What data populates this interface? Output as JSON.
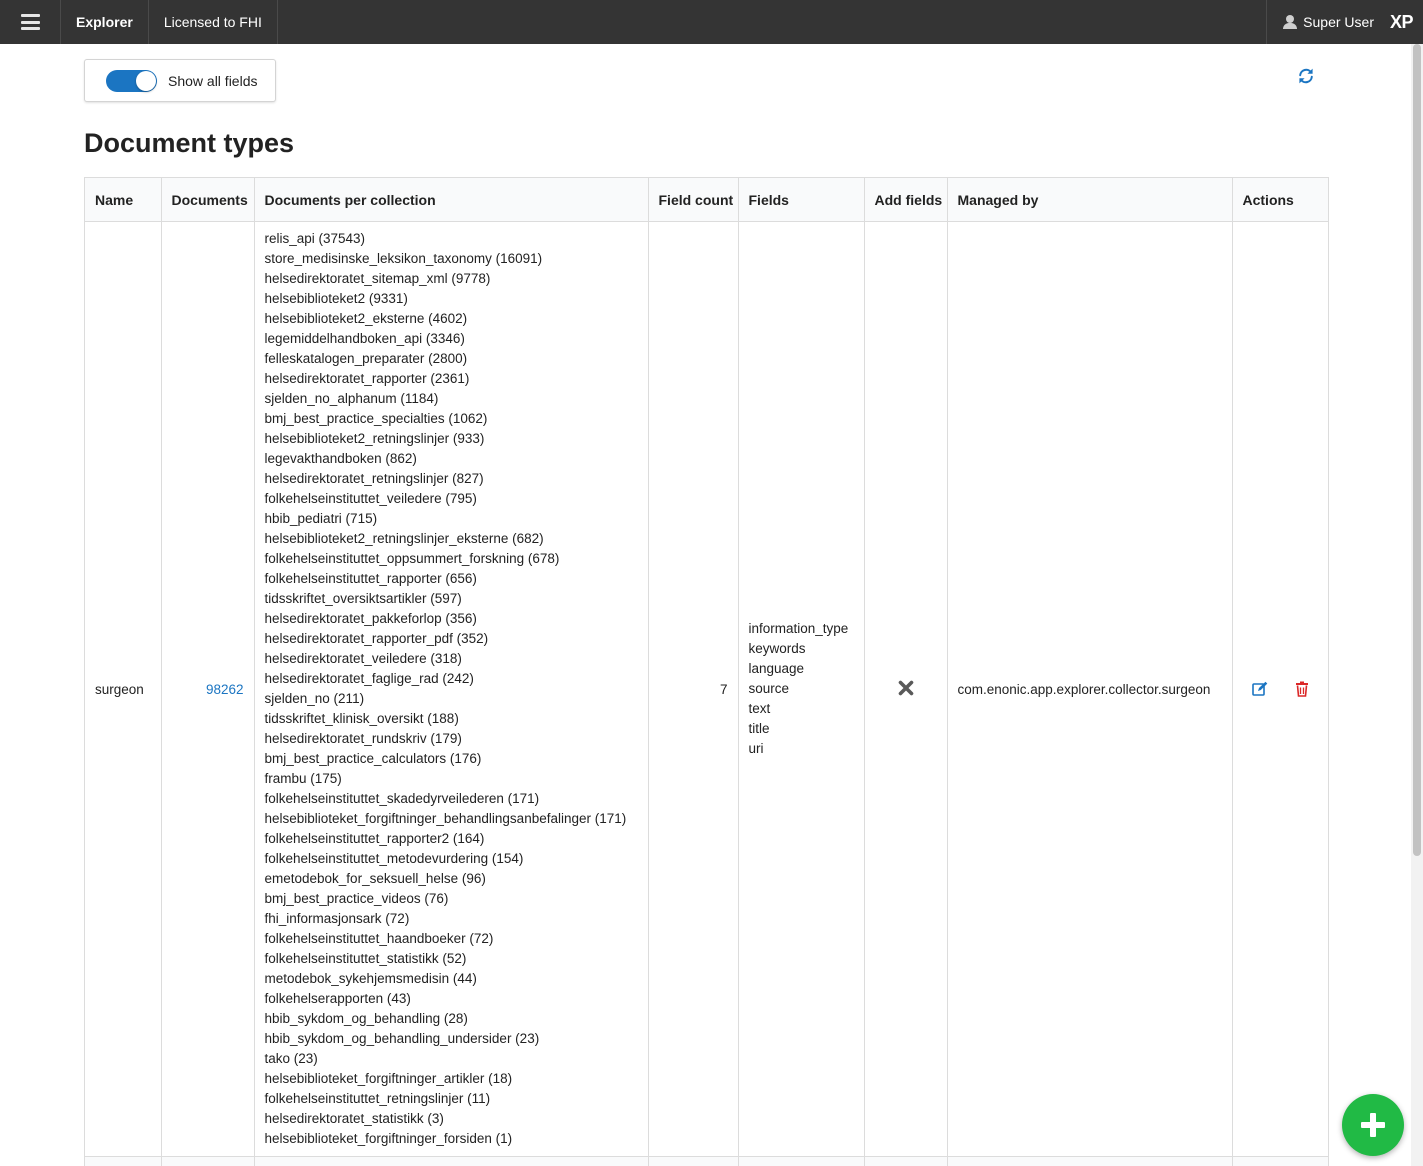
{
  "topbar": {
    "nav_items": [
      "Explorer",
      "Licensed to FHI"
    ],
    "user": "Super User",
    "logo": "XP",
    "menu_icon": "hamburger-icon",
    "user_icon": "user-icon"
  },
  "toolbar": {
    "toggle_label": "Show all fields",
    "toggle_on": true,
    "refresh_icon": "refresh-icon"
  },
  "page_title": "Document types",
  "table": {
    "columns": [
      "Name",
      "Documents",
      "Documents per collection",
      "Field count",
      "Fields",
      "Add fields",
      "Managed by",
      "Actions"
    ],
    "rows": [
      {
        "name": "surgeon",
        "documents": "98262",
        "collections": [
          "relis_api (37543)",
          "store_medisinske_leksikon_taxonomy (16091)",
          "helsedirektoratet_sitemap_xml (9778)",
          "helsebiblioteket2 (9331)",
          "helsebiblioteket2_eksterne (4602)",
          "legemiddelhandboken_api (3346)",
          "felleskatalogen_preparater (2800)",
          "helsedirektoratet_rapporter (2361)",
          "sjelden_no_alphanum (1184)",
          "bmj_best_practice_specialties (1062)",
          "helsebiblioteket2_retningslinjer (933)",
          "legevakthandboken (862)",
          "helsedirektoratet_retningslinjer (827)",
          "folkehelseinstituttet_veiledere (795)",
          "hbib_pediatri (715)",
          "helsebiblioteket2_retningslinjer_eksterne (682)",
          "folkehelseinstituttet_oppsummert_forskning (678)",
          "folkehelseinstituttet_rapporter (656)",
          "tidsskriftet_oversiktsartikler (597)",
          "helsedirektoratet_pakkeforlop (356)",
          "helsedirektoratet_rapporter_pdf (352)",
          "helsedirektoratet_veiledere (318)",
          "helsedirektoratet_faglige_rad (242)",
          "sjelden_no (211)",
          "tidsskriftet_klinisk_oversikt (188)",
          "helsedirektoratet_rundskriv (179)",
          "bmj_best_practice_calculators (176)",
          "frambu (175)",
          "folkehelseinstituttet_skadedyrveilederen (171)",
          "helsebiblioteket_forgiftninger_behandlingsanbefalinger (171)",
          "folkehelseinstituttet_rapporter2 (164)",
          "folkehelseinstituttet_metodevurdering (154)",
          "emetodebok_for_seksuell_helse (96)",
          "bmj_best_practice_videos (76)",
          "fhi_informasjonsark (72)",
          "folkehelseinstituttet_haandboeker (72)",
          "folkehelseinstituttet_statistikk (52)",
          "metodebok_sykehjemsmedisin (44)",
          "folkehelserapporten (43)",
          "hbib_sykdom_og_behandling (28)",
          "hbib_sykdom_og_behandling_undersider (23)",
          "tako (23)",
          "helsebiblioteket_forgiftninger_artikler (18)",
          "folkehelseinstituttet_retningslinjer (11)",
          "helsedirektoratet_statistikk (3)",
          "helsebiblioteket_forgiftninger_forsiden (1)"
        ],
        "field_count": "7",
        "fields": [
          "information_type",
          "keywords",
          "language",
          "source",
          "text",
          "title",
          "uri"
        ],
        "add_fields_icon": "close-icon",
        "managed_by": "com.enonic.app.explorer.collector.surgeon",
        "actions": [
          "edit-icon",
          "trash-icon"
        ]
      }
    ]
  },
  "fab_icon": "plus-icon",
  "colors": {
    "topbar_bg": "#343434",
    "accent": "#1b75c2",
    "delete": "#db2828",
    "fab": "#21ba45"
  }
}
